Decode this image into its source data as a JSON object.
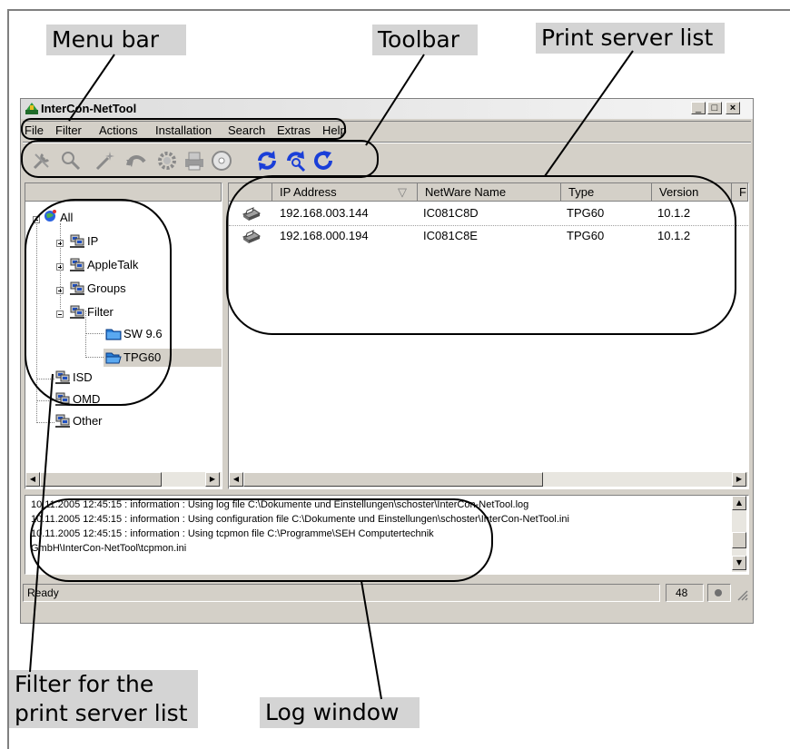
{
  "callouts": {
    "menu_bar": "Menu bar",
    "toolbar": "Toolbar",
    "print_server_list": "Print server list",
    "filter_list": "Filter for the print server list",
    "log_window": "Log window"
  },
  "window": {
    "title": "InterCon-NetTool",
    "minimize_glyph": "_",
    "maximize_glyph": "□",
    "close_glyph": "×"
  },
  "menu": [
    "File",
    "Filter",
    "Actions",
    "Installation",
    "Search",
    "Extras",
    "Help"
  ],
  "toolbar_icons": [
    "wrench-icon",
    "magnifier-tool-icon",
    "wand-icon",
    "undo-arrow-icon",
    "gear-icon",
    "printer-icon",
    "disc-icon",
    "refresh-icon",
    "search-refresh-icon",
    "reload-icon"
  ],
  "tree": {
    "root": "All",
    "items": [
      {
        "label": "IP",
        "expander": "+"
      },
      {
        "label": "AppleTalk",
        "expander": "+"
      },
      {
        "label": "Groups",
        "expander": "+"
      },
      {
        "label": "Filter",
        "expander": "-"
      }
    ],
    "filter_children": [
      "SW 9.6",
      "TPG60"
    ],
    "bottom_items": [
      "ISD",
      "OMD",
      "Other"
    ]
  },
  "list": {
    "columns": [
      "IP Address",
      "NetWare Name",
      "Type",
      "Version",
      "F"
    ],
    "sort_indicator": "▽",
    "rows": [
      {
        "ip": "192.168.003.144",
        "netware": "IC081C8D",
        "type": "TPG60",
        "version": "10.1.2"
      },
      {
        "ip": "192.168.000.194",
        "netware": "IC081C8E",
        "type": "TPG60",
        "version": "10.1.2"
      }
    ]
  },
  "log": [
    "10.11.2005 12:45:15 : information : Using log file C:\\Dokumente und Einstellungen\\schoster\\InterCon-NetTool.log",
    "10.11.2005 12:45:15 : information : Using configuration file C:\\Dokumente und Einstellungen\\schoster\\InterCon-NetTool.ini",
    "10.11.2005 12:45:15 : information : Using tcpmon file C:\\Programme\\SEH Computertechnik",
    "GmbH\\InterCon-NetTool\\tcpmon.ini"
  ],
  "status": {
    "text": "Ready",
    "count": "48"
  },
  "colors": {
    "callout_bg": "#d4d4d4",
    "window_face": "#d4d0c8",
    "refresh_blue": "#1a3fd8"
  }
}
